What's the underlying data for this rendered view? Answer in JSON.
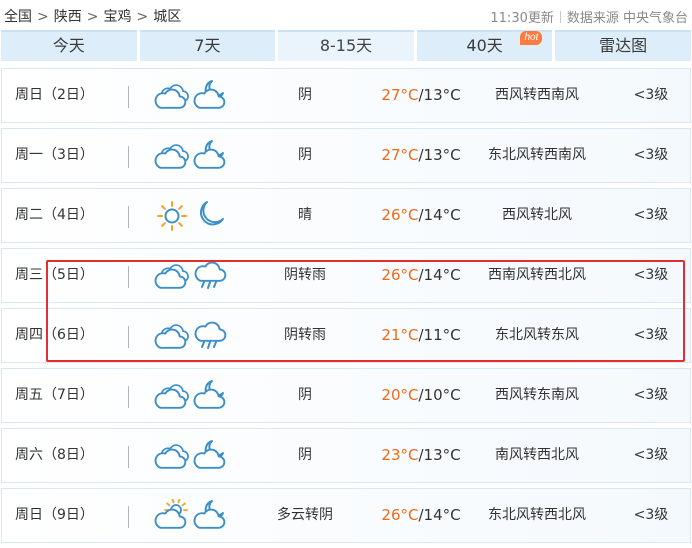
{
  "breadcrumb": {
    "items": [
      "全国",
      "陕西",
      "宝鸡",
      "城区"
    ],
    "separator": ">"
  },
  "meta": {
    "update_time": "11:30更新",
    "source": "数据来源 中央气象台"
  },
  "tabs": [
    {
      "label": "今天",
      "active": false,
      "hot": false
    },
    {
      "label": "7天",
      "active": false,
      "hot": false
    },
    {
      "label": "8-15天",
      "active": true,
      "hot": false
    },
    {
      "label": "40天",
      "active": false,
      "hot": true,
      "badge": "hot"
    },
    {
      "label": "雷达图",
      "active": false,
      "hot": false
    }
  ],
  "colors": {
    "high_temp": "#f06a1b",
    "icon_blue": "#3d8fc7",
    "sun": "#f2a22c",
    "highlight_border": "#e22e2e",
    "tab_bg": "#ddeefa"
  },
  "days": [
    {
      "day": "周日（2日）",
      "icon_day": "cloudy-icon",
      "icon_night": "cloudy-night-icon",
      "weather": "阴",
      "high": "27°C",
      "low": "/13°C",
      "wind": "西风转西南风",
      "level": "<3级"
    },
    {
      "day": "周一（3日）",
      "icon_day": "cloudy-icon",
      "icon_night": "cloudy-night-icon",
      "weather": "阴",
      "high": "27°C",
      "low": "/13°C",
      "wind": "东北风转西南风",
      "level": "<3级"
    },
    {
      "day": "周二（4日）",
      "icon_day": "sunny-icon",
      "icon_night": "moon-icon",
      "weather": "晴",
      "high": "26°C",
      "low": "/14°C",
      "wind": "西风转北风",
      "level": "<3级"
    },
    {
      "day": "周三（5日）",
      "icon_day": "cloudy-icon",
      "icon_night": "rain-icon",
      "weather": "阴转雨",
      "high": "26°C",
      "low": "/14°C",
      "wind": "西南风转西北风",
      "level": "<3级"
    },
    {
      "day": "周四（6日）",
      "icon_day": "cloudy-icon",
      "icon_night": "rain-icon",
      "weather": "阴转雨",
      "high": "21°C",
      "low": "/11°C",
      "wind": "东北风转东风",
      "level": "<3级"
    },
    {
      "day": "周五（7日）",
      "icon_day": "cloudy-icon",
      "icon_night": "cloudy-night-icon",
      "weather": "阴",
      "high": "20°C",
      "low": "/10°C",
      "wind": "西风转东南风",
      "level": "<3级"
    },
    {
      "day": "周六（8日）",
      "icon_day": "cloudy-icon",
      "icon_night": "cloudy-night-icon",
      "weather": "阴",
      "high": "23°C",
      "low": "/13°C",
      "wind": "南风转西北风",
      "level": "<3级"
    },
    {
      "day": "周日（9日）",
      "icon_day": "partly-cloudy-icon",
      "icon_night": "cloudy-night-icon",
      "weather": "多云转阴",
      "high": "26°C",
      "low": "/14°C",
      "wind": "东北风转西北风",
      "level": "<3级"
    }
  ]
}
